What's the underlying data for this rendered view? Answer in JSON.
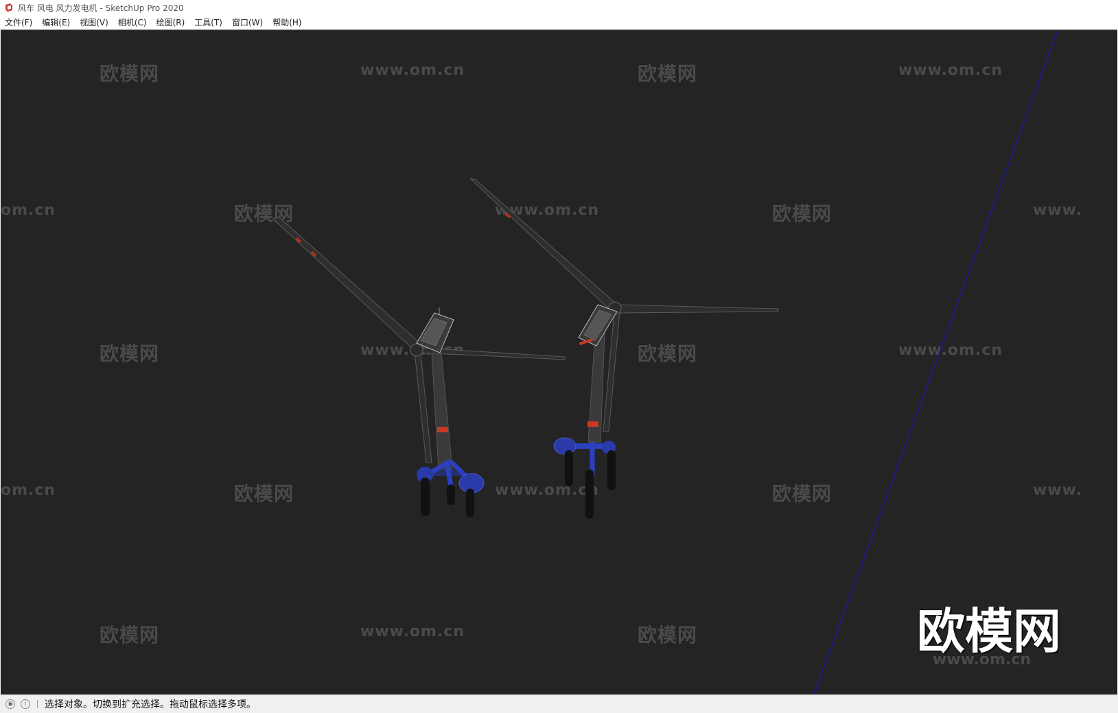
{
  "window": {
    "title": "风车 风电 风力发电机 - SketchUp Pro 2020",
    "app_icon": "sketchup-icon"
  },
  "menu": {
    "items": [
      "文件(F)",
      "编辑(E)",
      "视图(V)",
      "相机(C)",
      "绘图(R)",
      "工具(T)",
      "窗口(W)",
      "帮助(H)"
    ]
  },
  "viewport": {
    "background": "#242424",
    "watermark_logo": "欧模网",
    "watermark_url": "www.om.cn",
    "watermark_url_partial_left": "om.cn",
    "watermark_url_partial_right": "www.",
    "big_logo": "欧模网",
    "axis_color": "#1c1c8a"
  },
  "status": {
    "geo_icon": "geolocation-icon",
    "info_icon": "info-icon",
    "message": "选择对象。切换到扩充选择。拖动鼠标选择多项。"
  }
}
